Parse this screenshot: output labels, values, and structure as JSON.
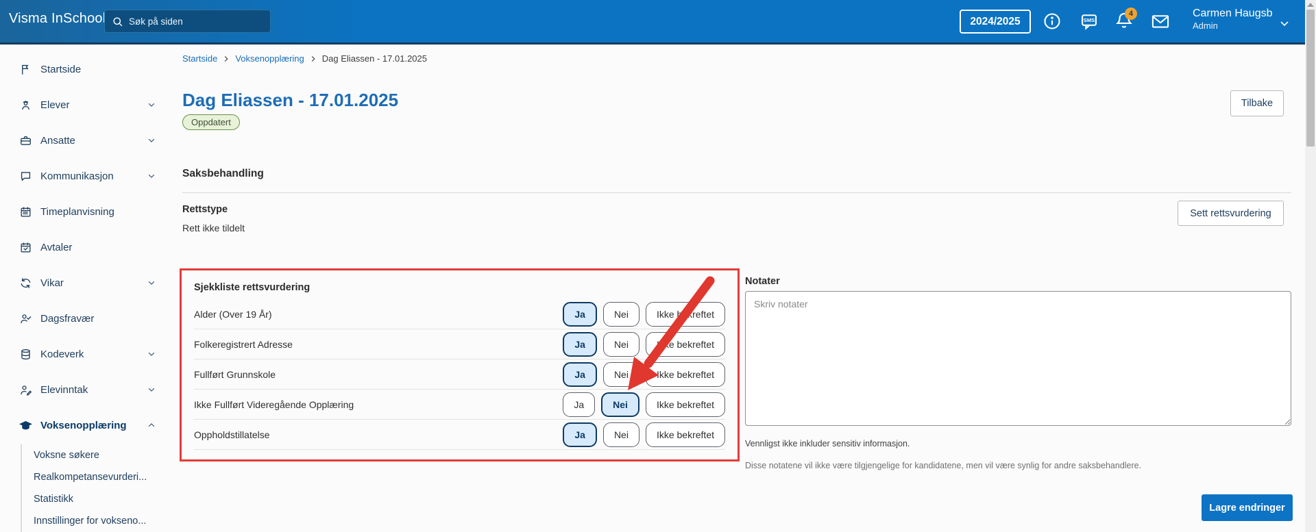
{
  "header": {
    "logo": "Visma InSchool",
    "search_placeholder": "Søk på siden",
    "year_selector": "2024/2025",
    "notification_count": "4",
    "user_name": "Carmen Haugsb",
    "user_role": "Admin"
  },
  "sidebar": {
    "items": [
      {
        "label": "Startside",
        "icon": "flag-icon",
        "chevron": null,
        "active": false
      },
      {
        "label": "Elever",
        "icon": "student-icon",
        "chevron": "down",
        "active": false
      },
      {
        "label": "Ansatte",
        "icon": "briefcase-icon",
        "chevron": "down",
        "active": false
      },
      {
        "label": "Kommunikasjon",
        "icon": "chat-icon",
        "chevron": "down",
        "active": false
      },
      {
        "label": "Timeplanvisning",
        "icon": "calendar-icon",
        "chevron": null,
        "active": false
      },
      {
        "label": "Avtaler",
        "icon": "calendar-check-icon",
        "chevron": null,
        "active": false
      },
      {
        "label": "Vikar",
        "icon": "refresh-icon",
        "chevron": "down",
        "active": false
      },
      {
        "label": "Dagsfravær",
        "icon": "user-check-icon",
        "chevron": null,
        "active": false
      },
      {
        "label": "Kodeverk",
        "icon": "database-icon",
        "chevron": "down",
        "active": false
      },
      {
        "label": "Elevinntak",
        "icon": "user-edit-icon",
        "chevron": "down",
        "active": false
      },
      {
        "label": "Voksenopplæring",
        "icon": "graduation-cap-icon",
        "chevron": "up",
        "active": true,
        "subitems": [
          "Voksne søkere",
          "Realkompetansevurderi...",
          "Statistikk",
          "Innstillinger for vokseno..."
        ]
      }
    ]
  },
  "breadcrumb": [
    {
      "label": "Startside",
      "link": true
    },
    {
      "label": "Voksenopplæring",
      "link": true
    },
    {
      "label": "Dag Eliassen - 17.01.2025",
      "link": false
    }
  ],
  "page": {
    "title": "Dag Eliassen - 17.01.2025",
    "status_badge": "Oppdatert",
    "back_button": "Tilbake"
  },
  "case_section": {
    "heading": "Saksbehandling",
    "rettstype_label": "Rettstype",
    "rettstype_value": "Rett ikke tildelt",
    "sett_button": "Sett rettsvurdering"
  },
  "checklist": {
    "heading": "Sjekkliste rettsvurdering",
    "options": [
      "Ja",
      "Nei",
      "Ikke bekreftet"
    ],
    "rows": [
      {
        "label": "Alder (Over 19 År)",
        "selected": "Ja"
      },
      {
        "label": "Folkeregistrert Adresse",
        "selected": "Ja"
      },
      {
        "label": "Fullført Grunnskole",
        "selected": "Ja"
      },
      {
        "label": "Ikke Fullført Videregående Opplæring",
        "selected": "Nei"
      },
      {
        "label": "Oppholdstillatelse",
        "selected": "Ja"
      }
    ]
  },
  "notes": {
    "label": "Notater",
    "placeholder": "Skriv notater",
    "helper1": "Vennligst ikke inkluder sensitiv informasjon.",
    "helper2": "Disse notatene vil ikke være tilgjengelige for kandidatene, men vil være synlig for andre saksbehandlere."
  },
  "save_button": "Lagre endringer",
  "colors": {
    "topbar_blue": "#0b73c2",
    "accent_blue": "#0d73c4",
    "title_blue": "#1d6db5",
    "selected_bg": "#d7eafb",
    "selected_border": "#0e3a63",
    "annotation_red": "#e0372e",
    "badge_orange": "#f0a22e",
    "badge_green_bg": "#e7f2d8",
    "badge_green_border": "#6b8f4a"
  }
}
